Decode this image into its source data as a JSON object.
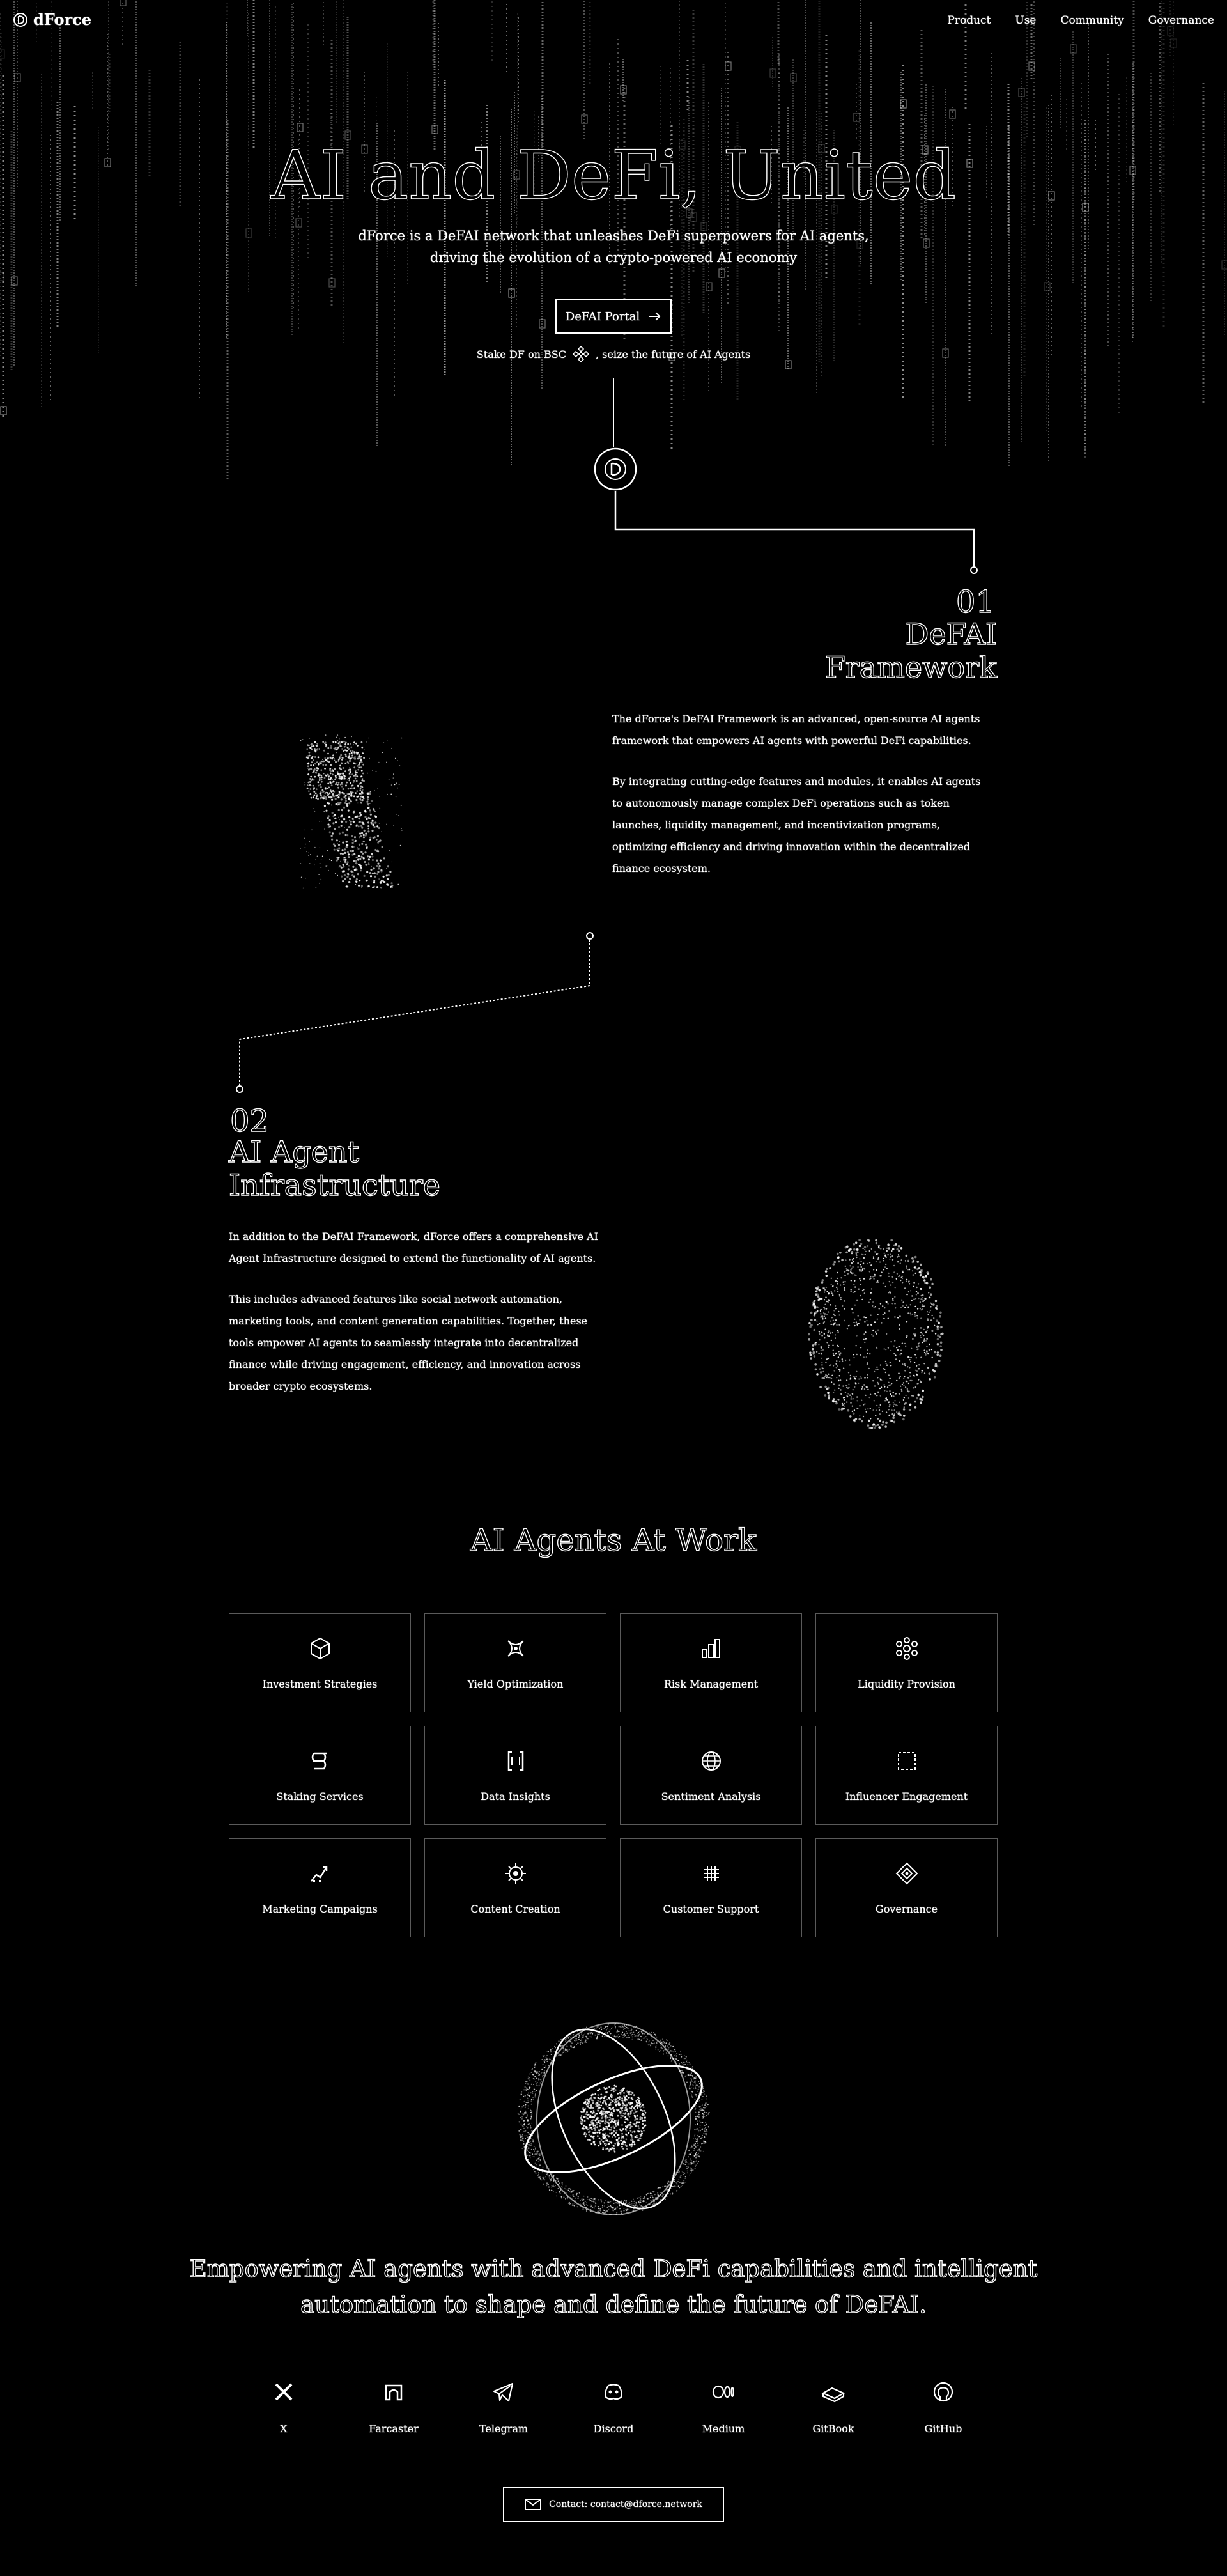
{
  "brand": {
    "name": "dForce"
  },
  "nav": {
    "items": [
      "Product",
      "Use",
      "Community",
      "Governance"
    ]
  },
  "hero": {
    "title": "AI and DeFi, United",
    "subtitle_line1": "dForce is a DeFAI network that unleashes DeFi superpowers for AI agents,",
    "subtitle_line2": "driving the evolution of a crypto-powered AI economy",
    "cta_label": "DeFAI Portal",
    "stake_before": "Stake DF on BSC",
    "stake_after": ", seize the future of AI Agents"
  },
  "sections": [
    {
      "num": "01",
      "title_line1": "DeFAI",
      "title_line2": "Framework",
      "paragraphs": [
        "The dForce's DeFAI Framework is an advanced, open-source AI agents framework that empowers AI agents with powerful DeFi capabilities.",
        "By integrating cutting-edge features and modules, it enables AI agents to autonomously manage complex DeFi operations such as token launches, liquidity management, and incentivization programs, optimizing efficiency and driving innovation within the decentralized finance ecosystem."
      ]
    },
    {
      "num": "02",
      "title_line1": "AI Agent",
      "title_line2": "Infrastructure",
      "paragraphs": [
        "In addition to the DeFAI Framework, dForce offers a comprehensive AI Agent Infrastructure designed to extend the functionality of AI agents.",
        "This includes advanced features like social network automation, marketing tools, and content generation capabilities. Together, these tools empower AI agents to seamlessly integrate into decentralized finance while driving engagement, efficiency, and innovation across broader crypto ecosystems."
      ]
    }
  ],
  "agents": {
    "title": "AI Agents At Work",
    "items": [
      {
        "label": "Investment Strategies",
        "icon": "cube-icon"
      },
      {
        "label": "Yield Optimization",
        "icon": "yield-icon"
      },
      {
        "label": "Risk Management",
        "icon": "bar-chart-icon"
      },
      {
        "label": "Liquidity Provision",
        "icon": "molecule-icon"
      },
      {
        "label": "Staking Services",
        "icon": "coin-stack-icon"
      },
      {
        "label": "Data Insights",
        "icon": "brackets-icon"
      },
      {
        "label": "Sentiment Analysis",
        "icon": "globe-icon"
      },
      {
        "label": "Influencer Engagement",
        "icon": "frame-icon"
      },
      {
        "label": "Marketing Campaigns",
        "icon": "chart-up-icon"
      },
      {
        "label": "Content Creation",
        "icon": "chip-icon"
      },
      {
        "label": "Customer Support",
        "icon": "grid-icon"
      },
      {
        "label": "Governance",
        "icon": "diamond-icon"
      }
    ]
  },
  "statement": {
    "line1": "Empowering AI agents with advanced DeFi capabilities and intelligent",
    "line2": "automation to shape and define the future of DeFAI."
  },
  "socials": [
    {
      "label": "X",
      "icon": "x-icon"
    },
    {
      "label": "Farcaster",
      "icon": "farcaster-icon"
    },
    {
      "label": "Telegram",
      "icon": "telegram-icon"
    },
    {
      "label": "Discord",
      "icon": "discord-icon"
    },
    {
      "label": "Medium",
      "icon": "medium-icon"
    },
    {
      "label": "GitBook",
      "icon": "gitbook-icon"
    },
    {
      "label": "GitHub",
      "icon": "github-icon"
    }
  ],
  "contact": {
    "label": "Contact: contact@dforce.network"
  }
}
